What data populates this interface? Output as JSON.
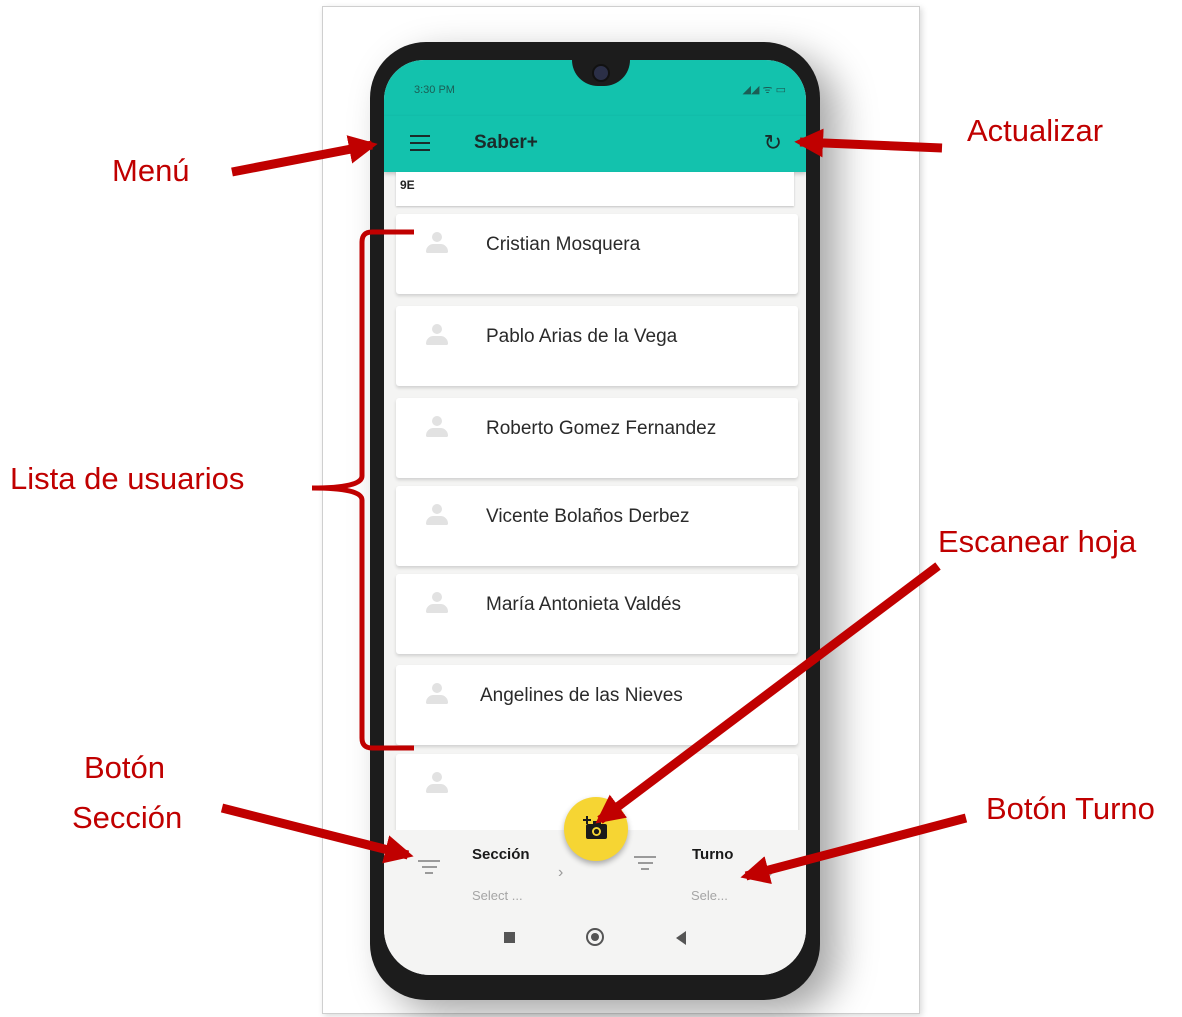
{
  "status_bar": {
    "time": "3:30 PM",
    "icons": "◢◢ ᯤ ▭"
  },
  "app_bar": {
    "title": "Saber+",
    "menu_icon": "menu-icon",
    "refresh_icon": "refresh-icon"
  },
  "section_header": "9E",
  "users": [
    {
      "name": "Cristian Mosquera"
    },
    {
      "name": "Pablo Arias de la Vega"
    },
    {
      "name": "Roberto Gomez Fernandez"
    },
    {
      "name": "Vicente Bolaños Derbez"
    },
    {
      "name": "María Antonieta Valdés"
    },
    {
      "name": "Angelines de las Nieves"
    },
    {
      "name": ""
    }
  ],
  "bottom_filters": {
    "seccion": {
      "label": "Sección",
      "value": "Select ..."
    },
    "turno": {
      "label": "Turno",
      "value": "Sele..."
    }
  },
  "fab": {
    "icon": "add-camera-icon",
    "color": "#f6d533"
  },
  "annotations": {
    "menu": "Menú",
    "actualizar": "Actualizar",
    "lista": "Lista de usuarios",
    "escanear": "Escanear hoja",
    "boton_seccion_1": "Botón",
    "boton_seccion_2": "Sección",
    "boton_turno": "Botón Turno"
  },
  "colors": {
    "app_bar": "#13c2ad",
    "annotation": "#c00000",
    "fab": "#f6d533"
  }
}
